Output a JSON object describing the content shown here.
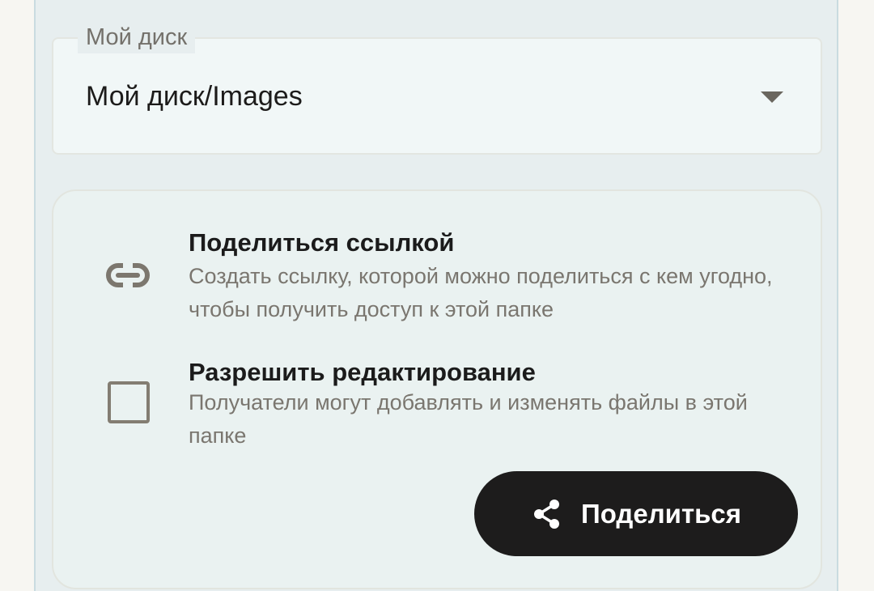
{
  "folder_select": {
    "label": "Мой диск",
    "value": "Мой диск/Images"
  },
  "share_link_option": {
    "title": "Поделиться ссылкой",
    "description": "Создать ссылку, которой можно поделиться с кем угодно, чтобы получить доступ к этой папке",
    "icon": "link-icon"
  },
  "allow_edit_option": {
    "title": "Разрешить редактирование",
    "description": "Получатели могут добавлять и изменять файлы в этой папке",
    "checked": false
  },
  "share_button": {
    "label": "Поделиться",
    "icon": "share-icon"
  },
  "colors": {
    "panel_background": "#e7eeef",
    "button_background": "#1d1c1c",
    "secondary_text": "#7a766f"
  }
}
